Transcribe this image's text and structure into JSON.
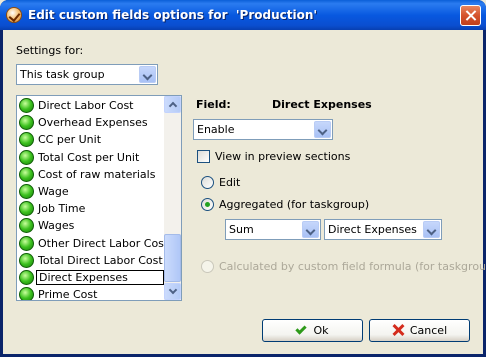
{
  "window": {
    "title": "Edit custom fields options for  'Production'"
  },
  "settings": {
    "label": "Settings for:",
    "selected": "This task group"
  },
  "list": {
    "items": [
      "Direct Labor Cost",
      "Overhead Expenses",
      "CC per Unit",
      "Total Cost per Unit",
      "Cost of raw materials",
      "Wage",
      "Job Time",
      "Wages",
      "Other Direct Labor Costs",
      "Total Direct Labor Cost",
      "Direct Expenses",
      "Prime Cost"
    ],
    "selected_index": 10
  },
  "field": {
    "label": "Field:",
    "name": "Direct Expenses",
    "state_selected": "Enable"
  },
  "options": {
    "view_preview_label": "View in preview sections",
    "edit_label": "Edit",
    "aggregated_label": "Aggregated (for taskgroup)",
    "aggregate_function": "Sum",
    "aggregate_source": "Direct Expenses",
    "calculated_label": "Calculated by custom field formula (for taskgroup)"
  },
  "buttons": {
    "ok": "Ok",
    "cancel": "Cancel"
  }
}
